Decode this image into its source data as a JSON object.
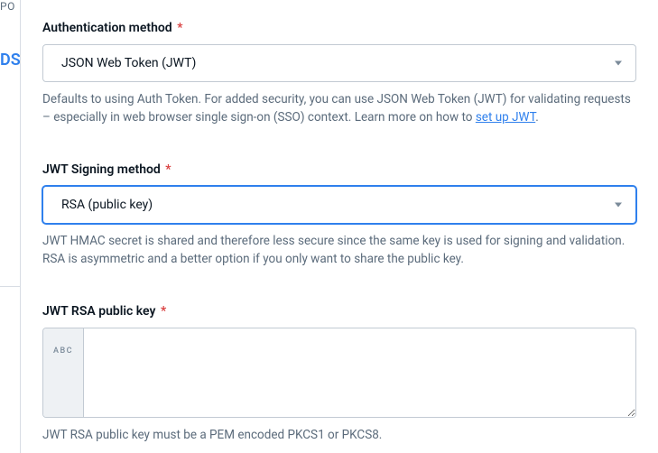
{
  "sidebar": {
    "top_fragment": "PO",
    "blue_fragment": "DS"
  },
  "auth_method": {
    "label": "Authentication method",
    "value": "JSON Web Token (JWT)",
    "help_pre": "Defaults to using Auth Token. For added security, you can use JSON Web Token (JWT) for validating requests – especially in web browser single sign-on (SSO) context. Learn more on how to ",
    "help_link": "set up JWT",
    "help_post": "."
  },
  "signing_method": {
    "label": "JWT Signing method",
    "value": "RSA (public key)",
    "help": "JWT HMAC secret is shared and therefore less secure since the same key is used for signing and validation. RSA is asymmetric and a better option if you only want to share the public key."
  },
  "rsa_key": {
    "label": "JWT RSA public key",
    "gutter": "ABC",
    "value": "",
    "help": "JWT RSA public key must be a PEM encoded PKCS1 or PKCS8."
  }
}
